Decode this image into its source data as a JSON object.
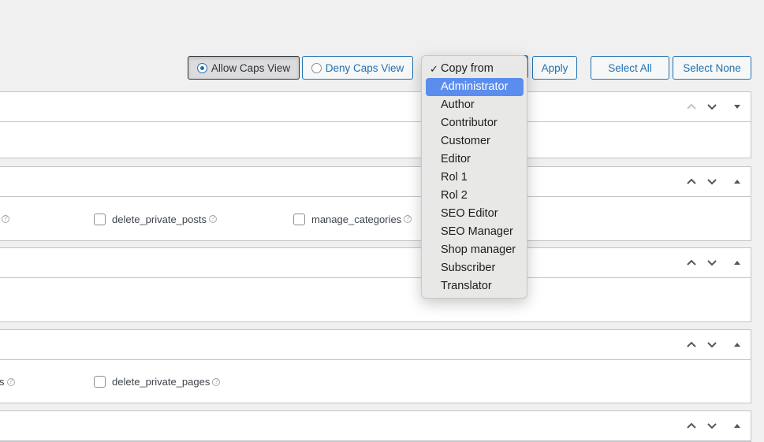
{
  "toolbar": {
    "allow_view": "Allow Caps View",
    "deny_view": "Deny Caps View",
    "apply": "Apply",
    "select_all": "Select All",
    "select_none": "Select None"
  },
  "dropdown": {
    "selected": "Copy from",
    "highlighted": "Administrator",
    "options": [
      "Copy from",
      "Administrator",
      "Author",
      "Contributor",
      "Customer",
      "Editor",
      "Rol 1",
      "Rol 2",
      "SEO Editor",
      "SEO Manager",
      "Shop manager",
      "Subscriber",
      "Translator"
    ]
  },
  "boxes": {
    "box2": {
      "cap1": "delete_private_posts",
      "cap2": "manage_categories"
    },
    "box4": {
      "cap1": "delete_private_pages",
      "cap0_tail": "s"
    },
    "help": "?"
  },
  "colors": {
    "accent": "#2271b1",
    "highlight": "#5b8def"
  }
}
